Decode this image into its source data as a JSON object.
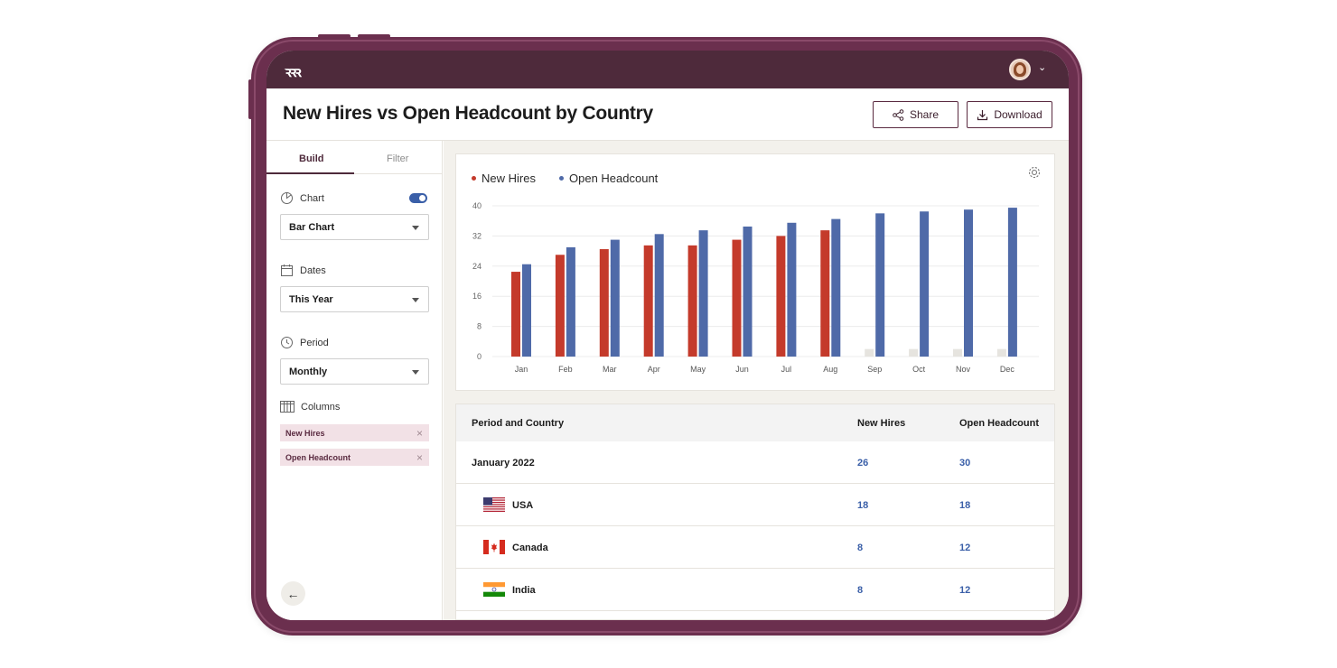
{
  "app": {
    "logo_text": "ꝛꝛꝛ"
  },
  "header": {
    "title": "New Hires vs Open Headcount by Country",
    "share_label": "Share",
    "download_label": "Download"
  },
  "sidebar": {
    "tabs": [
      {
        "label": "Build",
        "active": true
      },
      {
        "label": "Filter",
        "active": false
      }
    ],
    "chart": {
      "label": "Chart",
      "value": "Bar Chart",
      "toggle_on": true
    },
    "dates": {
      "label": "Dates",
      "value": "This Year"
    },
    "period": {
      "label": "Period",
      "value": "Monthly"
    },
    "columns": {
      "label": "Columns",
      "chips": [
        "New Hires",
        "Open Headcount"
      ]
    },
    "back_icon": "arrow-left-icon"
  },
  "colors": {
    "new_hires": "#c43a2b",
    "open_headcount": "#4f6aa8",
    "placeholder": "#e6e4df",
    "brand": "#4e2a3b"
  },
  "chart_data": {
    "type": "bar",
    "categories": [
      "Jan",
      "Feb",
      "Mar",
      "Apr",
      "May",
      "Jun",
      "Jul",
      "Aug",
      "Sep",
      "Oct",
      "Nov",
      "Dec"
    ],
    "series": [
      {
        "name": "New Hires",
        "values": [
          22.5,
          27,
          28.5,
          29.5,
          29.5,
          31,
          32,
          33.5,
          null,
          null,
          null,
          null
        ]
      },
      {
        "name": "Open Headcount",
        "values": [
          24.5,
          29,
          31,
          32.5,
          33.5,
          34.5,
          35.5,
          36.5,
          38,
          38.5,
          39,
          39.5
        ]
      }
    ],
    "placeholder_values": [
      null,
      null,
      null,
      null,
      null,
      null,
      null,
      null,
      2,
      2,
      2,
      2
    ],
    "yticks": [
      0,
      8,
      16,
      24,
      32,
      40
    ],
    "ylim": [
      0,
      40
    ],
    "legend_position": "top-left",
    "grid": true
  },
  "table": {
    "headers": [
      "Period and Country",
      "New Hires",
      "Open Headcount"
    ],
    "rows": [
      {
        "name": "January 2022",
        "new_hires": "26",
        "open_headcount": "30",
        "flag": null
      },
      {
        "name": "USA",
        "new_hires": "18",
        "open_headcount": "18",
        "flag": "usa-flag-icon"
      },
      {
        "name": "Canada",
        "new_hires": "8",
        "open_headcount": "12",
        "flag": "canada-flag-icon"
      },
      {
        "name": "India",
        "new_hires": "8",
        "open_headcount": "12",
        "flag": "india-flag-icon"
      }
    ]
  }
}
